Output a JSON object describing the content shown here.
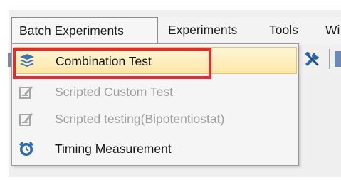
{
  "menubar": {
    "items": [
      {
        "label": "Batch Experiments"
      },
      {
        "label": "Experiments"
      },
      {
        "label": "Tools"
      },
      {
        "label": "Wi"
      }
    ]
  },
  "dropdown": {
    "items": [
      {
        "label": "Combination Test",
        "icon": "layers-icon",
        "enabled": true,
        "highlighted": true
      },
      {
        "label": "Scripted Custom Test",
        "icon": "edit-document-icon",
        "enabled": false
      },
      {
        "label": "Scripted testing(Bipotentiostat)",
        "icon": "edit-document-icon",
        "enabled": false
      },
      {
        "label": "Timing Measurement",
        "icon": "alarm-clock-icon",
        "enabled": true
      }
    ]
  },
  "colors": {
    "highlight_box": "#e52b2b",
    "hover_bg": "#fde7a8",
    "icon_blue": "#2a68b0",
    "disabled_text": "#9d9d9d"
  }
}
